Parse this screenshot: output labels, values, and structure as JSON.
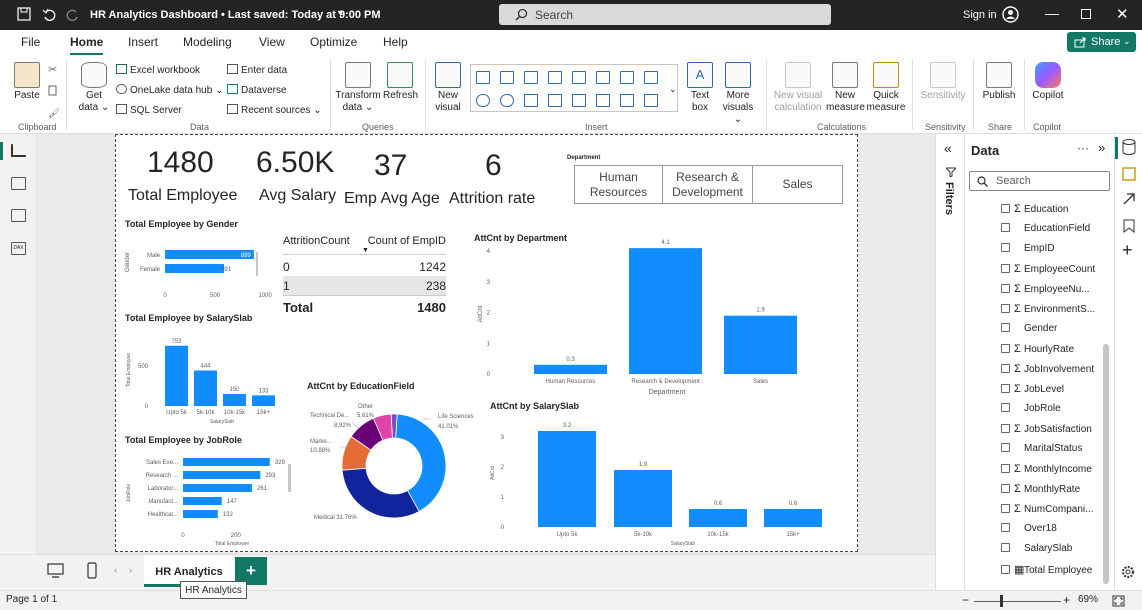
{
  "titlebar": {
    "title": "HR Analytics Dashboard • Last saved: Today at 9:00 PM",
    "search_placeholder": "Search",
    "signin": "Sign in"
  },
  "menu": [
    "File",
    "Home",
    "Insert",
    "Modeling",
    "View",
    "Optimize",
    "Help"
  ],
  "share": "Share",
  "ribbon": {
    "paste": "Paste",
    "get_data": "Get data",
    "excel": "Excel workbook",
    "onelake": "OneLake data hub",
    "sql": "SQL Server",
    "enter_data": "Enter data",
    "dataverse": "Dataverse",
    "recent": "Recent sources",
    "transform": "Transform data",
    "refresh": "Refresh",
    "new_visual": "New visual",
    "text_box": "Text box",
    "more_visuals": "More visuals",
    "new_visual_calc": "New visual calculation",
    "new_measure": "New measure",
    "quick_measure": "Quick measure",
    "sensitivity": "Sensitivity",
    "publish": "Publish",
    "copilot": "Copilot",
    "groups": {
      "clipboard": "Clipboard",
      "data": "Data",
      "queries": "Queries",
      "insert": "Insert",
      "calculations": "Calculations",
      "sensitivity": "Sensitivity",
      "share": "Share",
      "copilot": "Copilot"
    }
  },
  "kpis": [
    {
      "value": "1480",
      "label": "Total Employee"
    },
    {
      "value": "6.50K",
      "label": "Avg Salary"
    },
    {
      "value": "37",
      "label": "Emp Avg Age"
    },
    {
      "value": "6",
      "label": "Attrition rate"
    }
  ],
  "slicer": {
    "title": "Department",
    "options": [
      "Human Resources",
      "Research & Development",
      "Sales"
    ]
  },
  "table": {
    "headers": [
      "AttritionCount",
      "Count of EmpID"
    ],
    "rows": [
      [
        "0",
        "1242"
      ],
      [
        "1",
        "238"
      ]
    ],
    "total": [
      "Total",
      "1480"
    ]
  },
  "chart_data": [
    {
      "type": "bar",
      "orientation": "horizontal",
      "title": "Total Employee by Gender",
      "ylabel": "Gender",
      "categories": [
        "Male",
        "Female"
      ],
      "values": [
        889,
        591
      ],
      "xticks": [
        "0",
        "500",
        "1000"
      ],
      "xlim": [
        0,
        1000
      ]
    },
    {
      "type": "bar",
      "title": "Total Employee by SalarySlab",
      "xlabel": "SalarySlab",
      "ylabel": "Total Employee",
      "categories": [
        "Upto 5k",
        "5k-10k",
        "10k-15k",
        "15k+"
      ],
      "values": [
        753,
        444,
        150,
        133
      ],
      "yticks": [
        "0",
        "500"
      ],
      "ylim": [
        0,
        800
      ]
    },
    {
      "type": "bar",
      "orientation": "horizontal",
      "title": "Total Employee by JobRole",
      "xlabel": "Total Employee",
      "ylabel": "JobRole",
      "categories": [
        "Sales Exe...",
        "Research ...",
        "Laborator...",
        "Manufact...",
        "Healthcar..."
      ],
      "values": [
        329,
        293,
        261,
        147,
        132
      ],
      "xticks": [
        "0",
        "200"
      ],
      "xlim": [
        0,
        360
      ]
    },
    {
      "type": "bar",
      "title": "AttCnt by Department",
      "xlabel": "Department",
      "ylabel": "AttCnt",
      "categories": [
        "Human Resources",
        "Research & Development",
        "Sales"
      ],
      "values": [
        0.3,
        4.1,
        1.9
      ],
      "yticks": [
        "0",
        "1",
        "2",
        "3",
        "4"
      ],
      "ylim": [
        0,
        4.3
      ]
    },
    {
      "type": "pie",
      "donut": true,
      "title": "AttCnt by EducationField",
      "slices": [
        {
          "label": "Life Sciences",
          "pct": "41.01%",
          "value": 41.01,
          "color": "#118dff"
        },
        {
          "label": "Medical",
          "pct": "31.76%",
          "value": 31.76,
          "color": "#12239e"
        },
        {
          "label": "Marke...",
          "pct": "10.88%",
          "value": 10.88,
          "color": "#e66c37"
        },
        {
          "label": "Technical De...",
          "pct": "8.92%",
          "value": 8.92,
          "color": "#6b007b"
        },
        {
          "label": "Other",
          "pct": "5.61%",
          "value": 5.61,
          "color": "#e044a7"
        },
        {
          "label": "",
          "pct": "",
          "value": 1.82,
          "color": "#744ec2"
        }
      ]
    },
    {
      "type": "bar",
      "title": "AttCnt by SalarySlab",
      "xlabel": "SalarySlab",
      "ylabel": "AttCnt",
      "categories": [
        "Upto 5k",
        "5k-10k",
        "10k-15k",
        "15k+"
      ],
      "values": [
        3.2,
        1.9,
        0.6,
        0.6
      ],
      "yticks": [
        "0",
        "1",
        "2",
        "3"
      ],
      "ylim": [
        0,
        3.5
      ]
    }
  ],
  "data_pane": {
    "title": "Data",
    "search_placeholder": "Search",
    "fields": [
      {
        "name": "Education",
        "sigma": true
      },
      {
        "name": "EducationField",
        "sigma": false
      },
      {
        "name": "EmpID",
        "sigma": false
      },
      {
        "name": "EmployeeCount",
        "sigma": true
      },
      {
        "name": "EmployeeNu...",
        "sigma": true
      },
      {
        "name": "EnvironmentS...",
        "sigma": true
      },
      {
        "name": "Gender",
        "sigma": false
      },
      {
        "name": "HourlyRate",
        "sigma": true
      },
      {
        "name": "JobInvolvement",
        "sigma": true
      },
      {
        "name": "JobLevel",
        "sigma": true
      },
      {
        "name": "JobRole",
        "sigma": false
      },
      {
        "name": "JobSatisfaction",
        "sigma": true
      },
      {
        "name": "MaritalStatus",
        "sigma": false
      },
      {
        "name": "MonthlyIncome",
        "sigma": true
      },
      {
        "name": "MonthlyRate",
        "sigma": true
      },
      {
        "name": "NumCompani...",
        "sigma": true
      },
      {
        "name": "Over18",
        "sigma": false
      },
      {
        "name": "SalarySlab",
        "sigma": false
      },
      {
        "name": "Total Employee",
        "sigma": false,
        "calc": true
      }
    ]
  },
  "filters_label": "Filters",
  "tabs": {
    "page": "HR Analytics",
    "tooltip": "HR Analytics",
    "add": "+"
  },
  "status": {
    "page": "Page 1 of 1",
    "zoom": "69%",
    "zoom_fraction": 0.69
  },
  "colors": {
    "accent": "#117865",
    "bar": "#118dff"
  }
}
